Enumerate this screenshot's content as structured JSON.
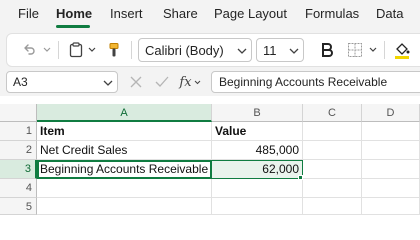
{
  "menu": {
    "items": [
      "File",
      "Home",
      "Insert",
      "Share",
      "Page Layout",
      "Formulas",
      "Data"
    ],
    "active_index": 1
  },
  "ribbon": {
    "font_name": "Calibri (Body)",
    "font_size": "11",
    "icons": [
      "undo-icon",
      "clipboard-icon",
      "format-painter-icon",
      "bold-icon",
      "borders-icon",
      "fill-color-icon"
    ]
  },
  "formula_bar": {
    "name_box": "A3",
    "fx_label": "fx",
    "formula": "Beginning Accounts Receivable"
  },
  "columns": [
    "A",
    "B",
    "C",
    "D"
  ],
  "rows": [
    "1",
    "2",
    "3",
    "4",
    "5"
  ],
  "cells": {
    "A1": "Item",
    "B1": "Value",
    "A2": "Net Credit Sales",
    "B2": "485,000",
    "A3": "Beginning Accounts Receivable",
    "B3": "62,000"
  },
  "colors": {
    "accent": "#107c41",
    "selection_fill": "#e9f3ec"
  }
}
